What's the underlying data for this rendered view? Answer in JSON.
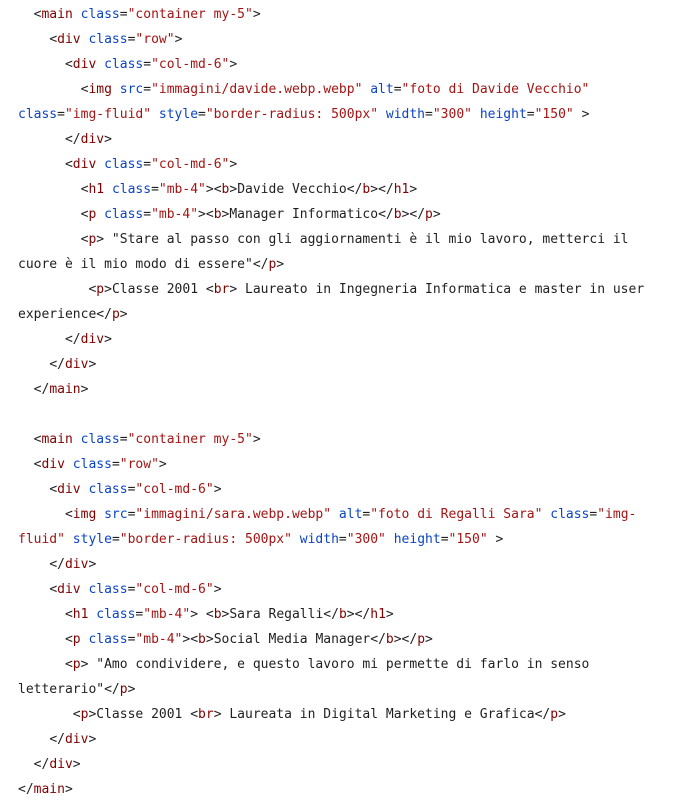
{
  "colors": {
    "background": "#ffffff",
    "tag": "#800000",
    "attribute": "#0b44c4",
    "value": "#a31515",
    "text": "#1f1f1f"
  },
  "code_lines": [
    [
      {
        "t": "  ",
        "k": "text"
      },
      {
        "t": "<",
        "k": "punct"
      },
      {
        "t": "main",
        "k": "tag"
      },
      {
        "t": " ",
        "k": "text"
      },
      {
        "t": "class",
        "k": "attr"
      },
      {
        "t": "=",
        "k": "punct"
      },
      {
        "t": "\"container my-5\"",
        "k": "val"
      },
      {
        "t": ">",
        "k": "punct"
      }
    ],
    [
      {
        "t": "    ",
        "k": "text"
      },
      {
        "t": "<",
        "k": "punct"
      },
      {
        "t": "div",
        "k": "tag"
      },
      {
        "t": " ",
        "k": "text"
      },
      {
        "t": "class",
        "k": "attr"
      },
      {
        "t": "=",
        "k": "punct"
      },
      {
        "t": "\"row\"",
        "k": "val"
      },
      {
        "t": ">",
        "k": "punct"
      }
    ],
    [
      {
        "t": "      ",
        "k": "text"
      },
      {
        "t": "<",
        "k": "punct"
      },
      {
        "t": "div",
        "k": "tag"
      },
      {
        "t": " ",
        "k": "text"
      },
      {
        "t": "class",
        "k": "attr"
      },
      {
        "t": "=",
        "k": "punct"
      },
      {
        "t": "\"col-md-6\"",
        "k": "val"
      },
      {
        "t": ">",
        "k": "punct"
      }
    ],
    [
      {
        "t": "        ",
        "k": "text"
      },
      {
        "t": "<",
        "k": "punct"
      },
      {
        "t": "img",
        "k": "tag"
      },
      {
        "t": " ",
        "k": "text"
      },
      {
        "t": "src",
        "k": "attr"
      },
      {
        "t": "=",
        "k": "punct"
      },
      {
        "t": "\"immagini/davide.webp.webp\"",
        "k": "val"
      },
      {
        "t": " ",
        "k": "text"
      },
      {
        "t": "alt",
        "k": "attr"
      },
      {
        "t": "=",
        "k": "punct"
      },
      {
        "t": "\"foto di Davide Vecchio\"",
        "k": "val"
      }
    ],
    [
      {
        "t": "class",
        "k": "attr"
      },
      {
        "t": "=",
        "k": "punct"
      },
      {
        "t": "\"img-fluid\"",
        "k": "val"
      },
      {
        "t": " ",
        "k": "text"
      },
      {
        "t": "style",
        "k": "attr"
      },
      {
        "t": "=",
        "k": "punct"
      },
      {
        "t": "\"border-radius: 500px\"",
        "k": "val"
      },
      {
        "t": " ",
        "k": "text"
      },
      {
        "t": "width",
        "k": "attr"
      },
      {
        "t": "=",
        "k": "punct"
      },
      {
        "t": "\"300\"",
        "k": "val"
      },
      {
        "t": " ",
        "k": "text"
      },
      {
        "t": "height",
        "k": "attr"
      },
      {
        "t": "=",
        "k": "punct"
      },
      {
        "t": "\"150\"",
        "k": "val"
      },
      {
        "t": " ",
        "k": "text"
      },
      {
        "t": ">",
        "k": "punct"
      }
    ],
    [
      {
        "t": "      ",
        "k": "text"
      },
      {
        "t": "</",
        "k": "punct"
      },
      {
        "t": "div",
        "k": "tag"
      },
      {
        "t": ">",
        "k": "punct"
      }
    ],
    [
      {
        "t": "      ",
        "k": "text"
      },
      {
        "t": "<",
        "k": "punct"
      },
      {
        "t": "div",
        "k": "tag"
      },
      {
        "t": " ",
        "k": "text"
      },
      {
        "t": "class",
        "k": "attr"
      },
      {
        "t": "=",
        "k": "punct"
      },
      {
        "t": "\"col-md-6\"",
        "k": "val"
      },
      {
        "t": ">",
        "k": "punct"
      }
    ],
    [
      {
        "t": "        ",
        "k": "text"
      },
      {
        "t": "<",
        "k": "punct"
      },
      {
        "t": "h1",
        "k": "tag"
      },
      {
        "t": " ",
        "k": "text"
      },
      {
        "t": "class",
        "k": "attr"
      },
      {
        "t": "=",
        "k": "punct"
      },
      {
        "t": "\"mb-4\"",
        "k": "val"
      },
      {
        "t": "><",
        "k": "punct"
      },
      {
        "t": "b",
        "k": "tag"
      },
      {
        "t": ">",
        "k": "punct"
      },
      {
        "t": "Davide Vecchio",
        "k": "text"
      },
      {
        "t": "</",
        "k": "punct"
      },
      {
        "t": "b",
        "k": "tag"
      },
      {
        "t": "></",
        "k": "punct"
      },
      {
        "t": "h1",
        "k": "tag"
      },
      {
        "t": ">",
        "k": "punct"
      }
    ],
    [
      {
        "t": "        ",
        "k": "text"
      },
      {
        "t": "<",
        "k": "punct"
      },
      {
        "t": "p",
        "k": "tag"
      },
      {
        "t": " ",
        "k": "text"
      },
      {
        "t": "class",
        "k": "attr"
      },
      {
        "t": "=",
        "k": "punct"
      },
      {
        "t": "\"mb-4\"",
        "k": "val"
      },
      {
        "t": "><",
        "k": "punct"
      },
      {
        "t": "b",
        "k": "tag"
      },
      {
        "t": ">",
        "k": "punct"
      },
      {
        "t": "Manager Informatico",
        "k": "text"
      },
      {
        "t": "</",
        "k": "punct"
      },
      {
        "t": "b",
        "k": "tag"
      },
      {
        "t": "></",
        "k": "punct"
      },
      {
        "t": "p",
        "k": "tag"
      },
      {
        "t": ">",
        "k": "punct"
      }
    ],
    [
      {
        "t": "        ",
        "k": "text"
      },
      {
        "t": "<",
        "k": "punct"
      },
      {
        "t": "p",
        "k": "tag"
      },
      {
        "t": ">",
        "k": "punct"
      },
      {
        "t": " \"Stare al passo con gli aggiornamenti è il mio lavoro, metterci il",
        "k": "text"
      }
    ],
    [
      {
        "t": "cuore è il mio modo di essere\"",
        "k": "text"
      },
      {
        "t": "</",
        "k": "punct"
      },
      {
        "t": "p",
        "k": "tag"
      },
      {
        "t": ">",
        "k": "punct"
      }
    ],
    [
      {
        "t": "         ",
        "k": "text"
      },
      {
        "t": "<",
        "k": "punct"
      },
      {
        "t": "p",
        "k": "tag"
      },
      {
        "t": ">",
        "k": "punct"
      },
      {
        "t": "Classe 2001 ",
        "k": "text"
      },
      {
        "t": "<",
        "k": "punct"
      },
      {
        "t": "br",
        "k": "tag"
      },
      {
        "t": ">",
        "k": "punct"
      },
      {
        "t": " Laureato in Ingegneria Informatica e master in user",
        "k": "text"
      }
    ],
    [
      {
        "t": "experience",
        "k": "text"
      },
      {
        "t": "</",
        "k": "punct"
      },
      {
        "t": "p",
        "k": "tag"
      },
      {
        "t": ">",
        "k": "punct"
      }
    ],
    [
      {
        "t": "      ",
        "k": "text"
      },
      {
        "t": "</",
        "k": "punct"
      },
      {
        "t": "div",
        "k": "tag"
      },
      {
        "t": ">",
        "k": "punct"
      }
    ],
    [
      {
        "t": "    ",
        "k": "text"
      },
      {
        "t": "</",
        "k": "punct"
      },
      {
        "t": "div",
        "k": "tag"
      },
      {
        "t": ">",
        "k": "punct"
      }
    ],
    [
      {
        "t": "  ",
        "k": "text"
      },
      {
        "t": "</",
        "k": "punct"
      },
      {
        "t": "main",
        "k": "tag"
      },
      {
        "t": ">",
        "k": "punct"
      }
    ],
    [],
    [
      {
        "t": "  ",
        "k": "text"
      },
      {
        "t": "<",
        "k": "punct"
      },
      {
        "t": "main",
        "k": "tag"
      },
      {
        "t": " ",
        "k": "text"
      },
      {
        "t": "class",
        "k": "attr"
      },
      {
        "t": "=",
        "k": "punct"
      },
      {
        "t": "\"container my-5\"",
        "k": "val"
      },
      {
        "t": ">",
        "k": "punct"
      }
    ],
    [
      {
        "t": "  ",
        "k": "text"
      },
      {
        "t": "<",
        "k": "punct"
      },
      {
        "t": "div",
        "k": "tag"
      },
      {
        "t": " ",
        "k": "text"
      },
      {
        "t": "class",
        "k": "attr"
      },
      {
        "t": "=",
        "k": "punct"
      },
      {
        "t": "\"row\"",
        "k": "val"
      },
      {
        "t": ">",
        "k": "punct"
      }
    ],
    [
      {
        "t": "    ",
        "k": "text"
      },
      {
        "t": "<",
        "k": "punct"
      },
      {
        "t": "div",
        "k": "tag"
      },
      {
        "t": " ",
        "k": "text"
      },
      {
        "t": "class",
        "k": "attr"
      },
      {
        "t": "=",
        "k": "punct"
      },
      {
        "t": "\"col-md-6\"",
        "k": "val"
      },
      {
        "t": ">",
        "k": "punct"
      }
    ],
    [
      {
        "t": "      ",
        "k": "text"
      },
      {
        "t": "<",
        "k": "punct"
      },
      {
        "t": "img",
        "k": "tag"
      },
      {
        "t": " ",
        "k": "text"
      },
      {
        "t": "src",
        "k": "attr"
      },
      {
        "t": "=",
        "k": "punct"
      },
      {
        "t": "\"immagini/sara.webp.webp\"",
        "k": "val"
      },
      {
        "t": " ",
        "k": "text"
      },
      {
        "t": "alt",
        "k": "attr"
      },
      {
        "t": "=",
        "k": "punct"
      },
      {
        "t": "\"foto di Regalli Sara\"",
        "k": "val"
      },
      {
        "t": " ",
        "k": "text"
      },
      {
        "t": "class",
        "k": "attr"
      },
      {
        "t": "=",
        "k": "punct"
      },
      {
        "t": "\"img-",
        "k": "val"
      }
    ],
    [
      {
        "t": "fluid\"",
        "k": "val"
      },
      {
        "t": " ",
        "k": "text"
      },
      {
        "t": "style",
        "k": "attr"
      },
      {
        "t": "=",
        "k": "punct"
      },
      {
        "t": "\"border-radius: 500px\"",
        "k": "val"
      },
      {
        "t": " ",
        "k": "text"
      },
      {
        "t": "width",
        "k": "attr"
      },
      {
        "t": "=",
        "k": "punct"
      },
      {
        "t": "\"300\"",
        "k": "val"
      },
      {
        "t": " ",
        "k": "text"
      },
      {
        "t": "height",
        "k": "attr"
      },
      {
        "t": "=",
        "k": "punct"
      },
      {
        "t": "\"150\"",
        "k": "val"
      },
      {
        "t": " ",
        "k": "text"
      },
      {
        "t": ">",
        "k": "punct"
      }
    ],
    [
      {
        "t": "    ",
        "k": "text"
      },
      {
        "t": "</",
        "k": "punct"
      },
      {
        "t": "div",
        "k": "tag"
      },
      {
        "t": ">",
        "k": "punct"
      }
    ],
    [
      {
        "t": "    ",
        "k": "text"
      },
      {
        "t": "<",
        "k": "punct"
      },
      {
        "t": "div",
        "k": "tag"
      },
      {
        "t": " ",
        "k": "text"
      },
      {
        "t": "class",
        "k": "attr"
      },
      {
        "t": "=",
        "k": "punct"
      },
      {
        "t": "\"col-md-6\"",
        "k": "val"
      },
      {
        "t": ">",
        "k": "punct"
      }
    ],
    [
      {
        "t": "      ",
        "k": "text"
      },
      {
        "t": "<",
        "k": "punct"
      },
      {
        "t": "h1",
        "k": "tag"
      },
      {
        "t": " ",
        "k": "text"
      },
      {
        "t": "class",
        "k": "attr"
      },
      {
        "t": "=",
        "k": "punct"
      },
      {
        "t": "\"mb-4\"",
        "k": "val"
      },
      {
        "t": ">",
        "k": "punct"
      },
      {
        "t": " ",
        "k": "text"
      },
      {
        "t": "<",
        "k": "punct"
      },
      {
        "t": "b",
        "k": "tag"
      },
      {
        "t": ">",
        "k": "punct"
      },
      {
        "t": "Sara Regalli",
        "k": "text"
      },
      {
        "t": "</",
        "k": "punct"
      },
      {
        "t": "b",
        "k": "tag"
      },
      {
        "t": "></",
        "k": "punct"
      },
      {
        "t": "h1",
        "k": "tag"
      },
      {
        "t": ">",
        "k": "punct"
      }
    ],
    [
      {
        "t": "      ",
        "k": "text"
      },
      {
        "t": "<",
        "k": "punct"
      },
      {
        "t": "p",
        "k": "tag"
      },
      {
        "t": " ",
        "k": "text"
      },
      {
        "t": "class",
        "k": "attr"
      },
      {
        "t": "=",
        "k": "punct"
      },
      {
        "t": "\"mb-4\"",
        "k": "val"
      },
      {
        "t": "><",
        "k": "punct"
      },
      {
        "t": "b",
        "k": "tag"
      },
      {
        "t": ">",
        "k": "punct"
      },
      {
        "t": "Social Media Manager",
        "k": "text"
      },
      {
        "t": "</",
        "k": "punct"
      },
      {
        "t": "b",
        "k": "tag"
      },
      {
        "t": "></",
        "k": "punct"
      },
      {
        "t": "p",
        "k": "tag"
      },
      {
        "t": ">",
        "k": "punct"
      }
    ],
    [
      {
        "t": "      ",
        "k": "text"
      },
      {
        "t": "<",
        "k": "punct"
      },
      {
        "t": "p",
        "k": "tag"
      },
      {
        "t": ">",
        "k": "punct"
      },
      {
        "t": " \"Amo condividere, e questo lavoro mi permette di farlo in senso",
        "k": "text"
      }
    ],
    [
      {
        "t": "letterario\"",
        "k": "text"
      },
      {
        "t": "</",
        "k": "punct"
      },
      {
        "t": "p",
        "k": "tag"
      },
      {
        "t": ">",
        "k": "punct"
      }
    ],
    [
      {
        "t": "       ",
        "k": "text"
      },
      {
        "t": "<",
        "k": "punct"
      },
      {
        "t": "p",
        "k": "tag"
      },
      {
        "t": ">",
        "k": "punct"
      },
      {
        "t": "Classe 2001 ",
        "k": "text"
      },
      {
        "t": "<",
        "k": "punct"
      },
      {
        "t": "br",
        "k": "tag"
      },
      {
        "t": ">",
        "k": "punct"
      },
      {
        "t": " Laureata in Digital Marketing e Grafica",
        "k": "text"
      },
      {
        "t": "</",
        "k": "punct"
      },
      {
        "t": "p",
        "k": "tag"
      },
      {
        "t": ">",
        "k": "punct"
      }
    ],
    [
      {
        "t": "    ",
        "k": "text"
      },
      {
        "t": "</",
        "k": "punct"
      },
      {
        "t": "div",
        "k": "tag"
      },
      {
        "t": ">",
        "k": "punct"
      }
    ],
    [
      {
        "t": "  ",
        "k": "text"
      },
      {
        "t": "</",
        "k": "punct"
      },
      {
        "t": "div",
        "k": "tag"
      },
      {
        "t": ">",
        "k": "punct"
      }
    ],
    [
      {
        "t": "</",
        "k": "punct"
      },
      {
        "t": "main",
        "k": "tag"
      },
      {
        "t": ">",
        "k": "punct"
      }
    ]
  ]
}
